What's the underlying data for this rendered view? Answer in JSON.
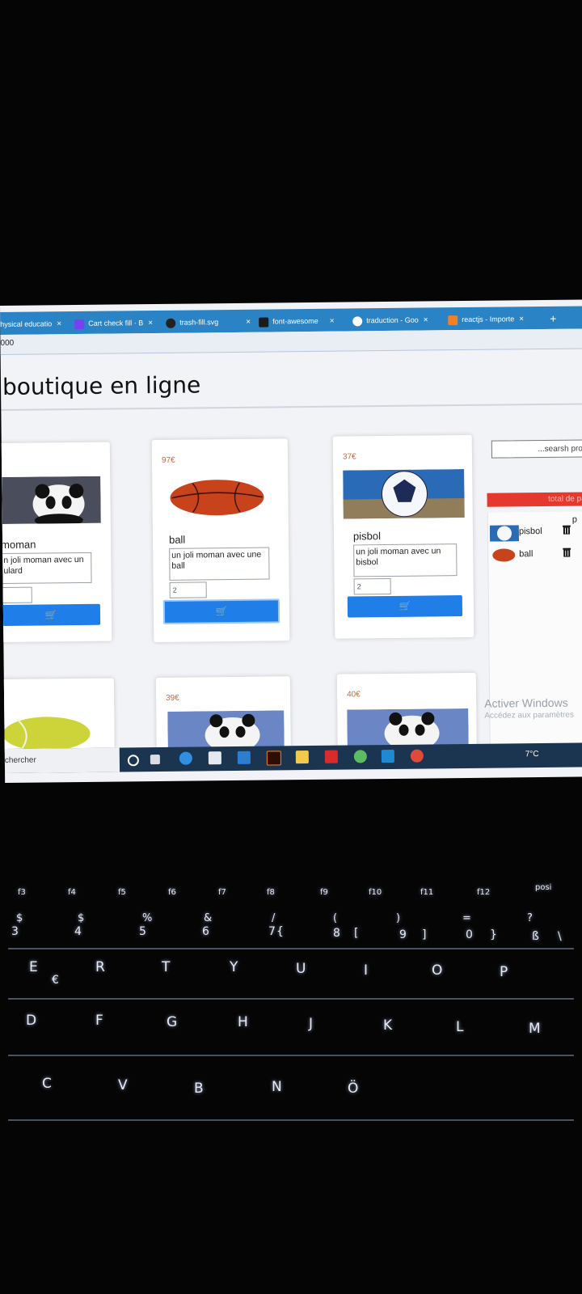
{
  "browser": {
    "tabs": [
      {
        "label": "hysical educatio",
        "icon": "blue-tab-icon"
      },
      {
        "label": "Cart check fill · B",
        "icon": "bootstrap-icon"
      },
      {
        "label": "trash-fill.svg",
        "icon": "github-icon"
      },
      {
        "label": "font-awesome",
        "icon": "font-awesome-icon"
      },
      {
        "label": "traduction - Goo",
        "icon": "google-icon"
      },
      {
        "label": "reactjs - Importe",
        "icon": "stackoverflow-icon"
      }
    ],
    "close_symbol": "×",
    "new_tab": "+",
    "url": "000"
  },
  "page": {
    "title": "boutique en ligne",
    "search_placeholder": "...searsh pro",
    "cart_total": "total de pani",
    "side_letter": "p"
  },
  "products": [
    {
      "price": "",
      "name": "moman",
      "description": "n joli moman avec un ulard",
      "qty": "",
      "image": "panda",
      "cart_icon": "🛒"
    },
    {
      "price": "97€",
      "name": "ball",
      "description": "un joli moman avec une ball",
      "qty": "2",
      "image": "basketball",
      "cart_icon": "🛒"
    },
    {
      "price": "37€",
      "name": "pisbol",
      "description": "un joli moman avec un bisbol",
      "qty": "2",
      "image": "soccer-ball",
      "cart_icon": "🛒"
    },
    {
      "price": "",
      "name": "",
      "description": "",
      "qty": "",
      "image": "tennis-ball"
    },
    {
      "price": "39€",
      "name": "",
      "description": "",
      "qty": "",
      "image": "panda"
    },
    {
      "price": "40€",
      "name": "",
      "description": "",
      "qty": "",
      "image": "panda"
    }
  ],
  "cart": [
    {
      "name": "pisbol",
      "image": "soccer-ball",
      "icon": "trash-icon"
    },
    {
      "name": "ball",
      "image": "basketball",
      "icon": "trash-icon"
    }
  ],
  "windows": {
    "activate_title": "Activer Windows",
    "activate_sub": "Accédez aux paramètres",
    "taskbar_search": "chercher",
    "weather": "7°C",
    "colors": {
      "taskbar": "#1b3550",
      "tabbar": "#2a83c4",
      "cart_button": "#1f7ee8",
      "total_bar": "#e5392f"
    }
  },
  "keyboard": {
    "function_keys": [
      "f3",
      "f4",
      "f5",
      "f6",
      "f7",
      "f8",
      "f9",
      "f10",
      "f11",
      "f12",
      "posi"
    ],
    "number_row_top": [
      "$",
      "$",
      "%",
      "&",
      "/",
      "(",
      ")",
      "=",
      "?"
    ],
    "number_row_bottom": [
      "3",
      "4",
      "5",
      "6",
      "7",
      "8",
      "9",
      "0",
      "ß"
    ],
    "row_e": [
      "E",
      "R",
      "T",
      "Y",
      "U",
      "I",
      "O",
      "P"
    ],
    "row_d": [
      "D",
      "F",
      "G",
      "H",
      "J",
      "K",
      "L",
      "M"
    ],
    "row_c": [
      "C",
      "V",
      "B",
      "N",
      "Ö"
    ],
    "extra_glyphs": [
      "€",
      "{",
      "[",
      "]",
      "}",
      "\\"
    ]
  }
}
